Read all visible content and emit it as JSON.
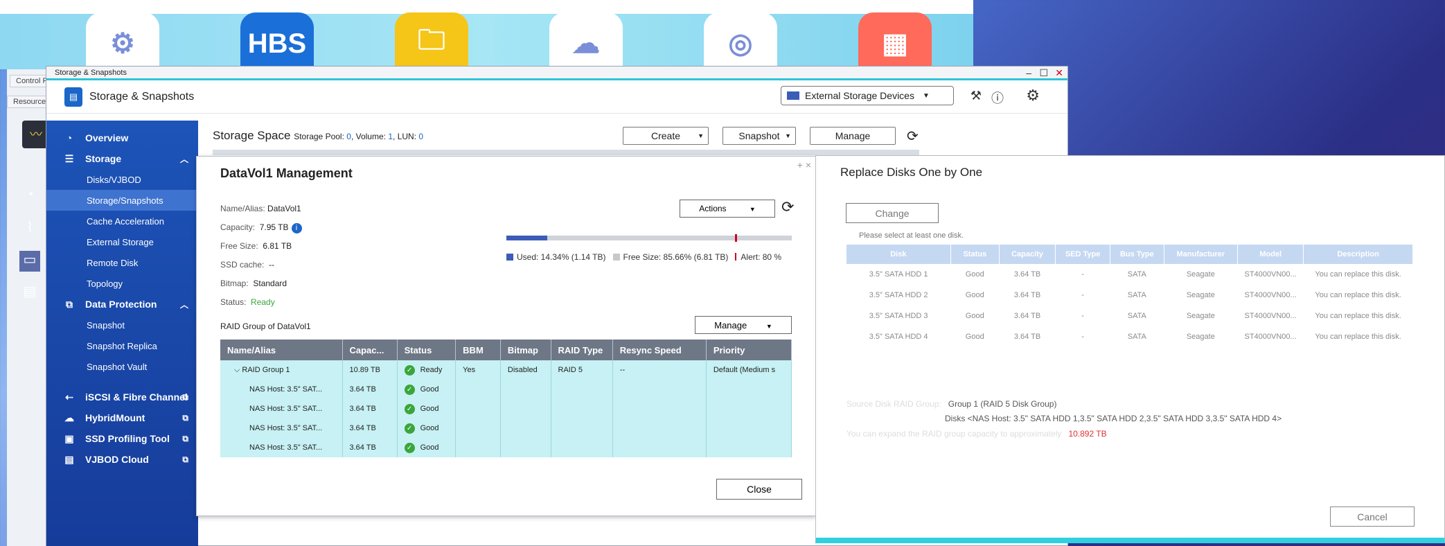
{
  "desktop": {
    "bg_tabs": [
      "Control P",
      "Resource"
    ],
    "apps": [
      {
        "icon": "gear-icon",
        "color": "#ffffff",
        "label": ""
      },
      {
        "icon": "hbs-icon",
        "color": "#1a6fd8",
        "label": "HBS"
      },
      {
        "icon": "folder-icon",
        "color": "#f5c518",
        "label": ""
      },
      {
        "icon": "cloud-icon",
        "color": "#ffffff",
        "label": ""
      },
      {
        "icon": "target-icon",
        "color": "#ffffff",
        "label": ""
      },
      {
        "icon": "grid-icon",
        "color": "#ff6a5a",
        "label": ""
      }
    ]
  },
  "window": {
    "title": "Storage & Snapshots",
    "app_title": "Storage & Snapshots",
    "external_storage_label": "External Storage Devices"
  },
  "sidebar": {
    "items": [
      {
        "label": "Overview",
        "type": "main"
      },
      {
        "label": "Storage",
        "type": "main",
        "arrow": "^"
      },
      {
        "label": "Disks/VJBOD",
        "type": "sub"
      },
      {
        "label": "Storage/Snapshots",
        "type": "sub",
        "active": true
      },
      {
        "label": "Cache Acceleration",
        "type": "sub"
      },
      {
        "label": "External Storage",
        "type": "sub"
      },
      {
        "label": "Remote Disk",
        "type": "sub"
      },
      {
        "label": "Topology",
        "type": "sub"
      },
      {
        "label": "Data Protection",
        "type": "main",
        "arrow": "^"
      },
      {
        "label": "Snapshot",
        "type": "sub"
      },
      {
        "label": "Snapshot Replica",
        "type": "sub"
      },
      {
        "label": "Snapshot Vault",
        "type": "sub"
      },
      {
        "label": "iSCSI & Fibre Channel",
        "type": "main",
        "ext": true
      },
      {
        "label": "HybridMount",
        "type": "main",
        "ext": true
      },
      {
        "label": "SSD Profiling Tool",
        "type": "main",
        "ext": true
      },
      {
        "label": "VJBOD Cloud",
        "type": "main",
        "ext": true
      }
    ]
  },
  "storage_space": {
    "title": "Storage Space",
    "pool_label": "Storage Pool:",
    "pool_count": "0",
    "volume_label": "Volume:",
    "volume_count": "1",
    "lun_label": "LUN:",
    "lun_count": "0",
    "create_label": "Create",
    "snapshot_label": "Snapshot",
    "manage_label": "Manage"
  },
  "datavol": {
    "title": "DataVol1  Management",
    "name_label": "Name/Alias:",
    "name_value": "DataVol1",
    "capacity_label": "Capacity:",
    "capacity_value": "7.95 TB",
    "free_label": "Free Size:",
    "free_value": "6.81 TB",
    "ssd_label": "SSD cache:",
    "ssd_value": "--",
    "bitmap_label": "Bitmap:",
    "bitmap_value": "Standard",
    "status_label": "Status:",
    "status_value": "Ready",
    "actions_label": "Actions",
    "used_pct": 14.34,
    "alert_pct": 80,
    "used_text": "Used: 14.34% (1.14 TB)",
    "free_text": "Free Size: 85.66% (6.81 TB)",
    "alert_text": "Alert: 80 %",
    "raid_group_label": "RAID Group of DataVol1",
    "manage_label": "Manage",
    "close_label": "Close",
    "columns": [
      "Name/Alias",
      "Capac...",
      "Status",
      "BBM",
      "Bitmap",
      "RAID Type",
      "Resync Speed",
      "Priority"
    ],
    "rows": [
      {
        "name": "RAID Group 1",
        "cap": "10.89 TB",
        "status": "Ready",
        "bbm": "Yes",
        "bitmap": "Disabled",
        "raid": "RAID 5",
        "resync": "--",
        "priority": "Default (Medium s",
        "group": true
      },
      {
        "name": "NAS Host: 3.5\" SAT...",
        "cap": "3.64 TB",
        "status": "Good",
        "bbm": "",
        "bitmap": "",
        "raid": "",
        "resync": "",
        "priority": ""
      },
      {
        "name": "NAS Host: 3.5\" SAT...",
        "cap": "3.64 TB",
        "status": "Good",
        "bbm": "",
        "bitmap": "",
        "raid": "",
        "resync": "",
        "priority": ""
      },
      {
        "name": "NAS Host: 3.5\" SAT...",
        "cap": "3.64 TB",
        "status": "Good",
        "bbm": "",
        "bitmap": "",
        "raid": "",
        "resync": "",
        "priority": ""
      },
      {
        "name": "NAS Host: 3.5\" SAT...",
        "cap": "3.64 TB",
        "status": "Good",
        "bbm": "",
        "bitmap": "",
        "raid": "",
        "resync": "",
        "priority": ""
      }
    ]
  },
  "replace": {
    "title": "Replace Disks One by One",
    "change_label": "Change",
    "hint": "Please select at least one disk.",
    "columns": [
      "Disk",
      "Status",
      "Capacity",
      "SED Type",
      "Bus Type",
      "Manufacturer",
      "Model",
      "Description"
    ],
    "rows": [
      [
        "3.5\" SATA HDD 1",
        "Good",
        "3.64 TB",
        "-",
        "SATA",
        "Seagate",
        "ST4000VN00...",
        "You can replace this disk."
      ],
      [
        "3.5\" SATA HDD 2",
        "Good",
        "3.64 TB",
        "-",
        "SATA",
        "Seagate",
        "ST4000VN00...",
        "You can replace this disk."
      ],
      [
        "3.5\" SATA HDD 3",
        "Good",
        "3.64 TB",
        "-",
        "SATA",
        "Seagate",
        "ST4000VN00...",
        "You can replace this disk."
      ],
      [
        "3.5\" SATA HDD 4",
        "Good",
        "3.64 TB",
        "-",
        "SATA",
        "Seagate",
        "ST4000VN00...",
        "You can replace this disk."
      ]
    ],
    "source_label": "Source Disk RAID Group:",
    "source_value": "Group 1 (RAID 5 Disk Group)",
    "disks_value": "Disks <NAS Host: 3.5\" SATA HDD 1,3.5\" SATA HDD 2,3.5\" SATA HDD 3,3.5\" SATA HDD 4>",
    "expand_label": "You can expand the RAID group capacity to approximately",
    "expand_value": "10.892 TB",
    "cancel_label": "Cancel"
  }
}
